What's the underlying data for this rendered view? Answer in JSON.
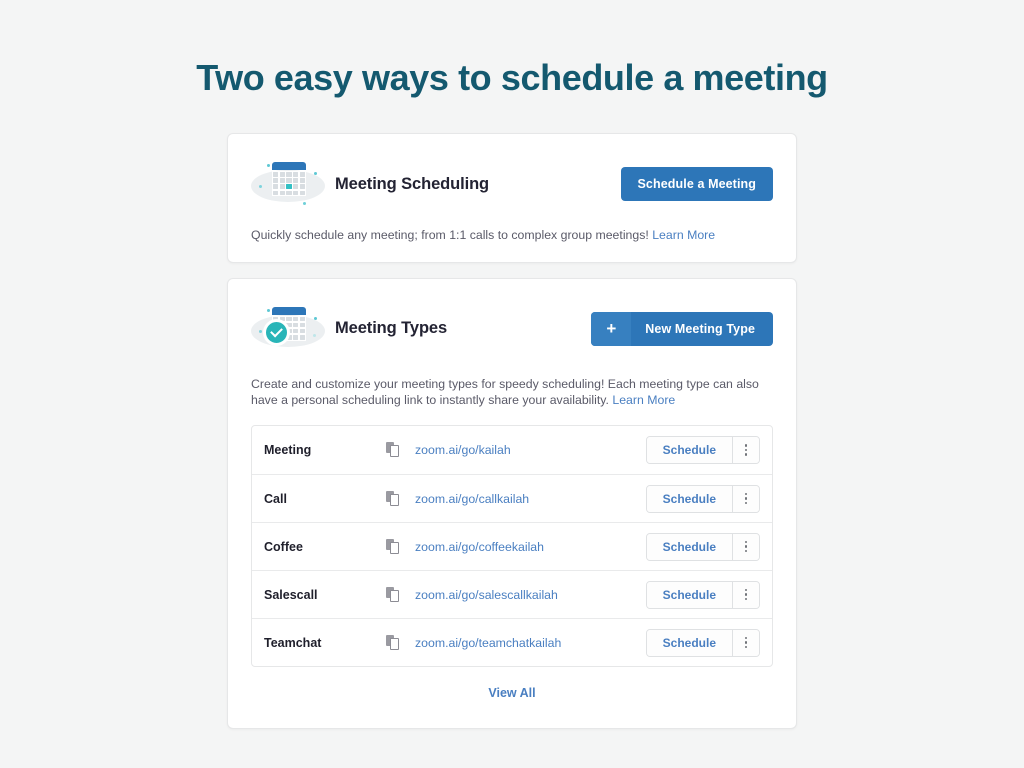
{
  "page": {
    "title": "Two easy ways to schedule a meeting",
    "title_color": "#14596f",
    "background_color": "#f4f5f5",
    "accent_blue": "#2d76b8",
    "link_blue": "#4a7fc1",
    "teal": "#29b5b8"
  },
  "scheduling_card": {
    "icon": "calendar-icon",
    "heading": "Meeting Scheduling",
    "primary_button": "Schedule a Meeting",
    "description": "Quickly schedule any meeting; from 1:1 calls to complex group meetings!",
    "learn_more": "Learn More"
  },
  "meeting_types_card": {
    "icon": "calendar-check-icon",
    "heading": "Meeting Types",
    "new_button": {
      "plus": "+",
      "label": "New Meeting Type"
    },
    "description": "Create and customize your meeting types for speedy scheduling! Each meeting type can also have a personal scheduling link to instantly share your availability.",
    "learn_more": "Learn More",
    "row_action_label": "Schedule",
    "copy_icon": "copy-icon",
    "kebab_icon": "more-vertical-icon",
    "rows": [
      {
        "name": "Meeting",
        "link": "zoom.ai/go/kailah"
      },
      {
        "name": "Call",
        "link": "zoom.ai/go/callkailah"
      },
      {
        "name": "Coffee",
        "link": "zoom.ai/go/coffeekailah"
      },
      {
        "name": "Salescall",
        "link": "zoom.ai/go/salescallkailah"
      },
      {
        "name": "Teamchat",
        "link": "zoom.ai/go/teamchatkailah"
      }
    ],
    "view_all": "View All"
  }
}
